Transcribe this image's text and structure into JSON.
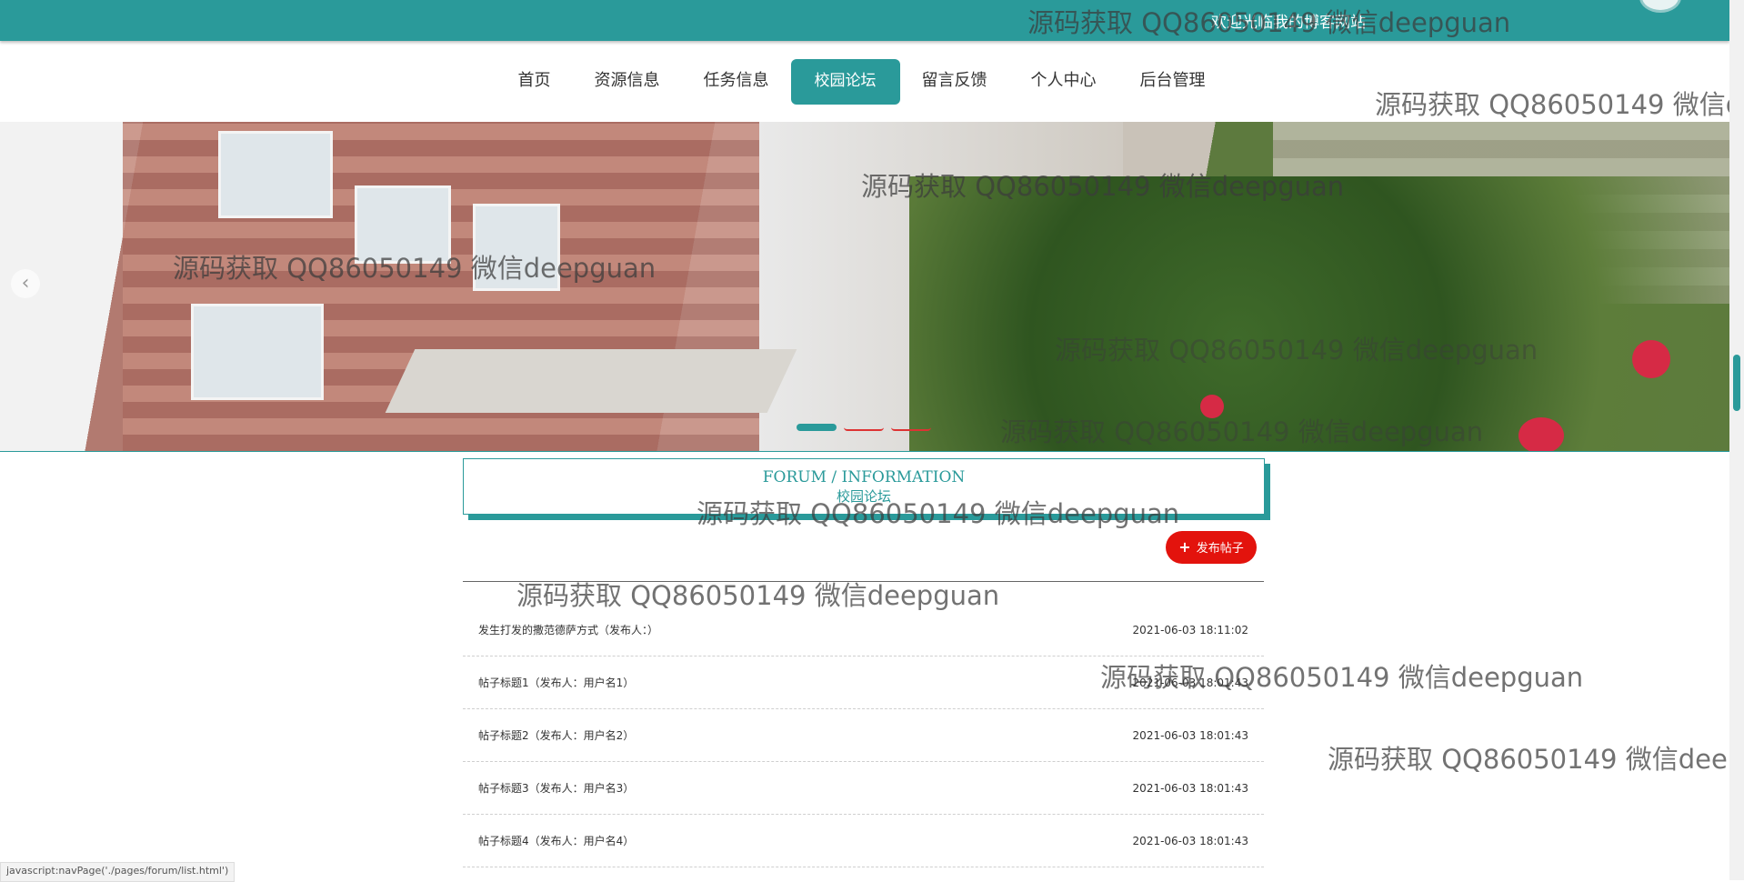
{
  "header": {
    "welcome": "欢迎光临我的博客网站"
  },
  "nav": {
    "items": [
      "首页",
      "资源信息",
      "任务信息",
      "校园论坛",
      "留言反馈",
      "个人中心",
      "后台管理"
    ],
    "active_index": 3
  },
  "banner": {
    "prev_arrow": "‹",
    "slide_count": 3,
    "active_slide": 0
  },
  "section": {
    "title_en": "FORUM / INFORMATION",
    "title_cn": "校园论坛"
  },
  "post_button": {
    "icon": "+",
    "label": "发布帖子"
  },
  "posts": [
    {
      "title": "发生打发的撒范德萨方式（发布人：）",
      "time": "2021-06-03 18:11:02"
    },
    {
      "title": "帖子标题1（发布人：用户名1）",
      "time": "2021-06-03 18:01:43"
    },
    {
      "title": "帖子标题2（发布人：用户名2）",
      "time": "2021-06-03 18:01:43"
    },
    {
      "title": "帖子标题3（发布人：用户名3）",
      "time": "2021-06-03 18:01:43"
    },
    {
      "title": "帖子标题4（发布人：用户名4）",
      "time": "2021-06-03 18:01:43"
    }
  ],
  "status_bar": "javascript:navPage('./pages/forum/list.html')",
  "watermark_text": "源码获取 QQ86050149 微信deepguan",
  "colors": {
    "accent": "#2a9a9a",
    "post_button": "#e3130d"
  }
}
